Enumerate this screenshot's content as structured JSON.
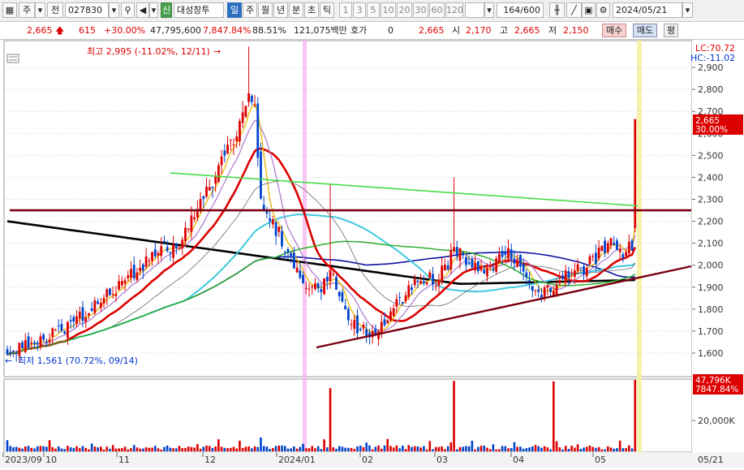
{
  "toolbar": {
    "market_label": "주",
    "type_label": "전",
    "code_value": "027830",
    "new_badge": "신",
    "stock_name": "대성창투",
    "periods": [
      "일",
      "주",
      "월",
      "년",
      "분",
      "초",
      "틱"
    ],
    "selected_period": "일",
    "intervals": [
      "1",
      "3",
      "5",
      "10",
      "20",
      "30",
      "60",
      "120"
    ],
    "count_value": "164",
    "count_total": "/600",
    "date_value": "2024/05/21"
  },
  "quote": {
    "price": "2,665",
    "change": "615",
    "change_rate": "+30.00%",
    "volume": "47,795,600",
    "volume_ratio": "7,847.84%",
    "turnover": "88.51%",
    "amount": "121,075백만",
    "hoga_label": "호가",
    "hoga_value": "0",
    "current_value": "2,665",
    "open_label": "시",
    "open_value": "2,170",
    "high_label": "고",
    "high_value": "2,665",
    "low_label": "저",
    "low_value": "2,150",
    "buy_button": "매수",
    "sell_button": "매도",
    "avg_button": "평"
  },
  "chart": {
    "lc_label": "LC:70.72",
    "hc_label": "HC:-11.02",
    "high_annotation": "최고 2,995 (-11.02%, 12/11)",
    "low_annotation": "최저 1,561 (70.72%, 09/14)",
    "last_price_tag": "2,665",
    "last_change_tag": "30.00%",
    "volume_tag": "47,796K",
    "volume_ratio_tag": "7847.84%",
    "volume_axis_label": "20,000K"
  },
  "chart_data": {
    "type": "candlestick",
    "y_ticks": [
      1600,
      1700,
      1800,
      1900,
      2000,
      2100,
      2200,
      2300,
      2400,
      2500,
      2600,
      2700,
      2800,
      2900
    ],
    "y_tick_labels": [
      "1,600",
      "1,700",
      "1,800",
      "1,900",
      "2,000",
      "2,100",
      "2,200",
      "2,300",
      "2,400",
      "2,500",
      "2,600",
      "2,700",
      "2,800",
      "2,900"
    ],
    "ylim": [
      1540,
      3030
    ],
    "x_labels": [
      "2023/09",
      "10",
      "11",
      "12",
      "2024/01",
      "02",
      "03",
      "04",
      "05",
      "05/21"
    ],
    "high": 2995,
    "low": 1561,
    "last_close": 2665,
    "horizontal_line": 2250,
    "colors": {
      "up": "#dd0000",
      "down": "#0044cc",
      "ma5": "#e8b800",
      "ma10": "#b080d0",
      "ma20": "#dd0000",
      "ma60": "#40c8e0",
      "ma120": "#1010a0",
      "ma240": "#000000",
      "ma_green": "#22aa22",
      "line_long": "#44dd44",
      "resistance": "#7a0010",
      "trend": "#7a0010"
    }
  }
}
